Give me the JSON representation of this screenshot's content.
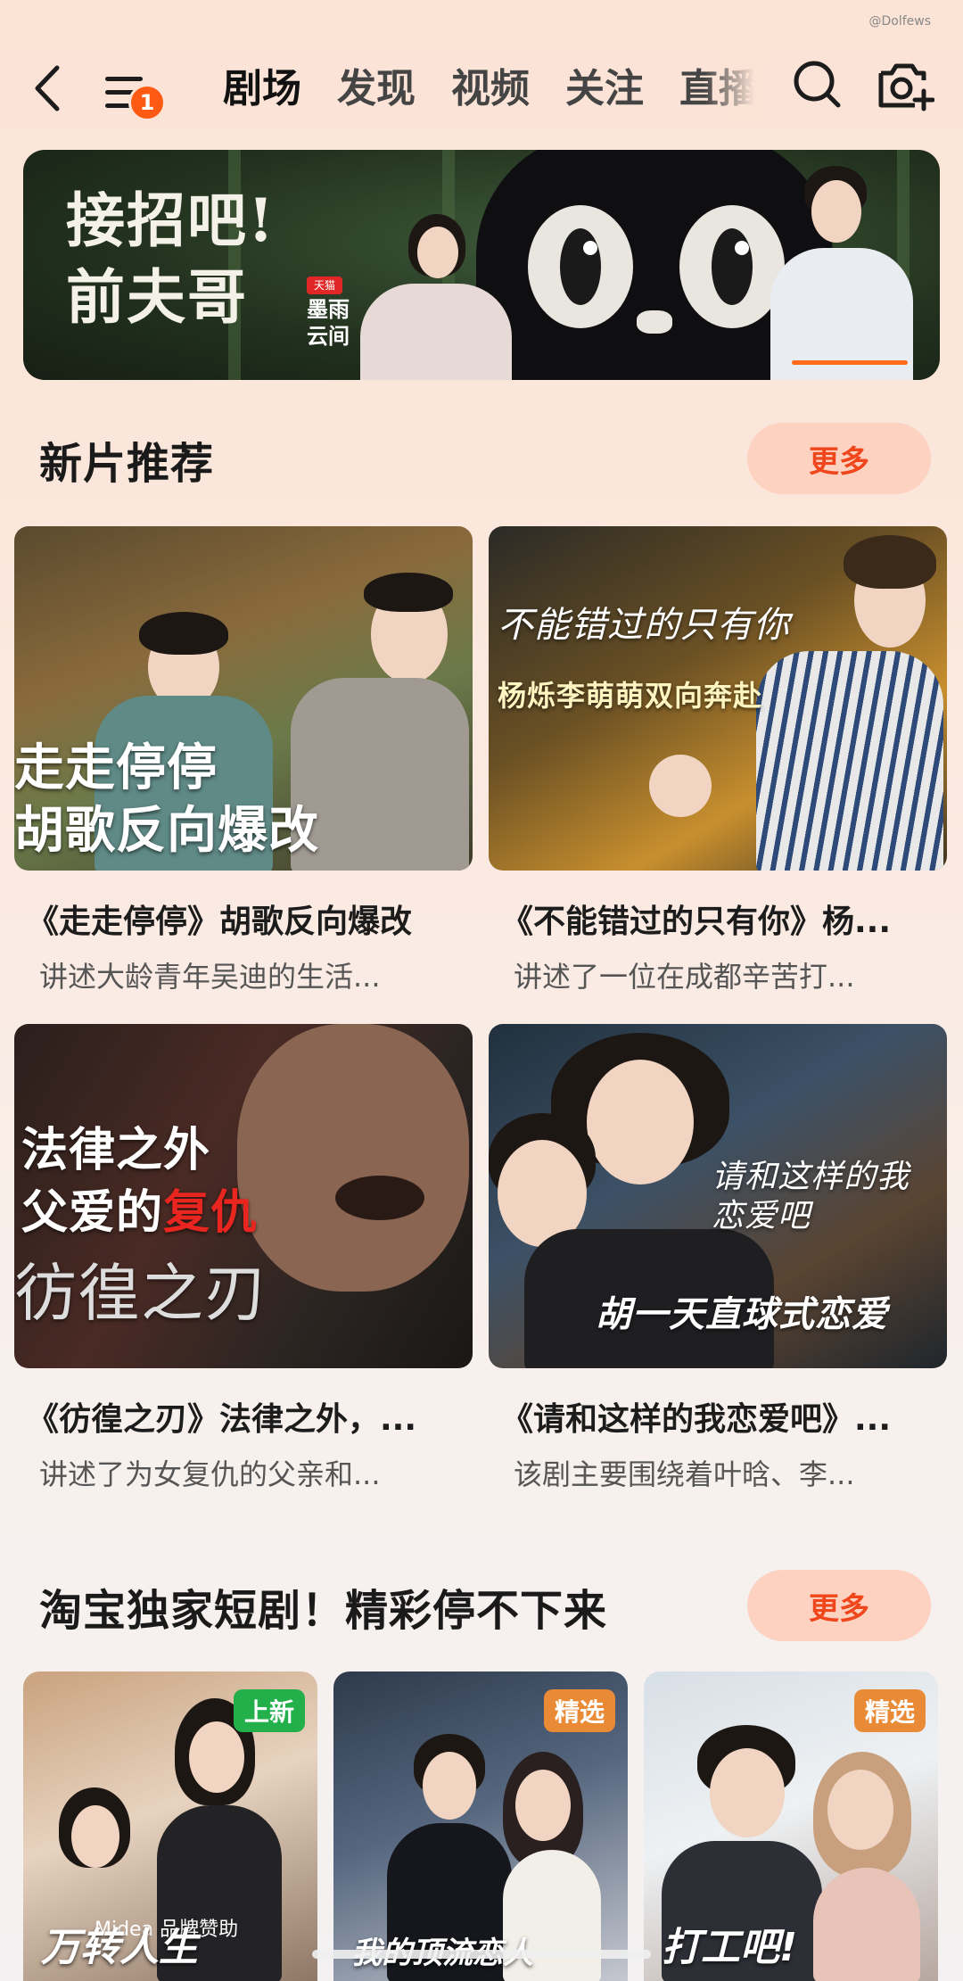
{
  "watermark": "@Dolfews",
  "header": {
    "badge_count": "1",
    "tabs": [
      "剧场",
      "发现",
      "视频",
      "关注",
      "直播"
    ],
    "active_tab": "剧场"
  },
  "banner": {
    "title_line1": "接招吧!",
    "title_line2": "前夫哥",
    "brand_tag": "天猫",
    "brand_line1": "墨雨",
    "brand_line2": "云间"
  },
  "new_releases": {
    "title": "新片推荐",
    "more_label": "更多",
    "items": [
      {
        "overlay1": "走走停停",
        "overlay2": "胡歌反向爆改",
        "title": "《走走停停》胡歌反向爆改",
        "desc": "讲述大龄青年吴迪的生活..."
      },
      {
        "overlay1": "不能错过的只有你",
        "overlay2": "杨烁李萌萌双向奔赴",
        "title": "《不能错过的只有你》杨...",
        "desc": "讲述了一位在成都辛苦打..."
      },
      {
        "overlay1": "法律之外",
        "overlay2": "父爱的",
        "overlay2_red": "复仇",
        "overlay3": "彷徨之刃",
        "title": "《彷徨之刃》法律之外，...",
        "desc": "讲述了为女复仇的父亲和..."
      },
      {
        "overlay1": "请和这样的我恋爱吧",
        "overlay2": "胡一天直球式恋爱",
        "title": "《请和这样的我恋爱吧》...",
        "desc": "该剧主要围绕着叶晗、李..."
      }
    ]
  },
  "short_dramas": {
    "title": "淘宝独家短剧！精彩停不下来",
    "more_label": "更多",
    "items": [
      {
        "tag": "上新",
        "tag_color": "#23b04a",
        "sponsor": "Midea 品牌赞助",
        "caption": "万转人生"
      },
      {
        "tag": "精选",
        "tag_color": "#e88a36",
        "sponsor": "",
        "caption": "我的顶流恋人"
      },
      {
        "tag": "精选",
        "tag_color": "#e88a36",
        "sponsor": "",
        "caption": "打工吧!"
      }
    ]
  }
}
